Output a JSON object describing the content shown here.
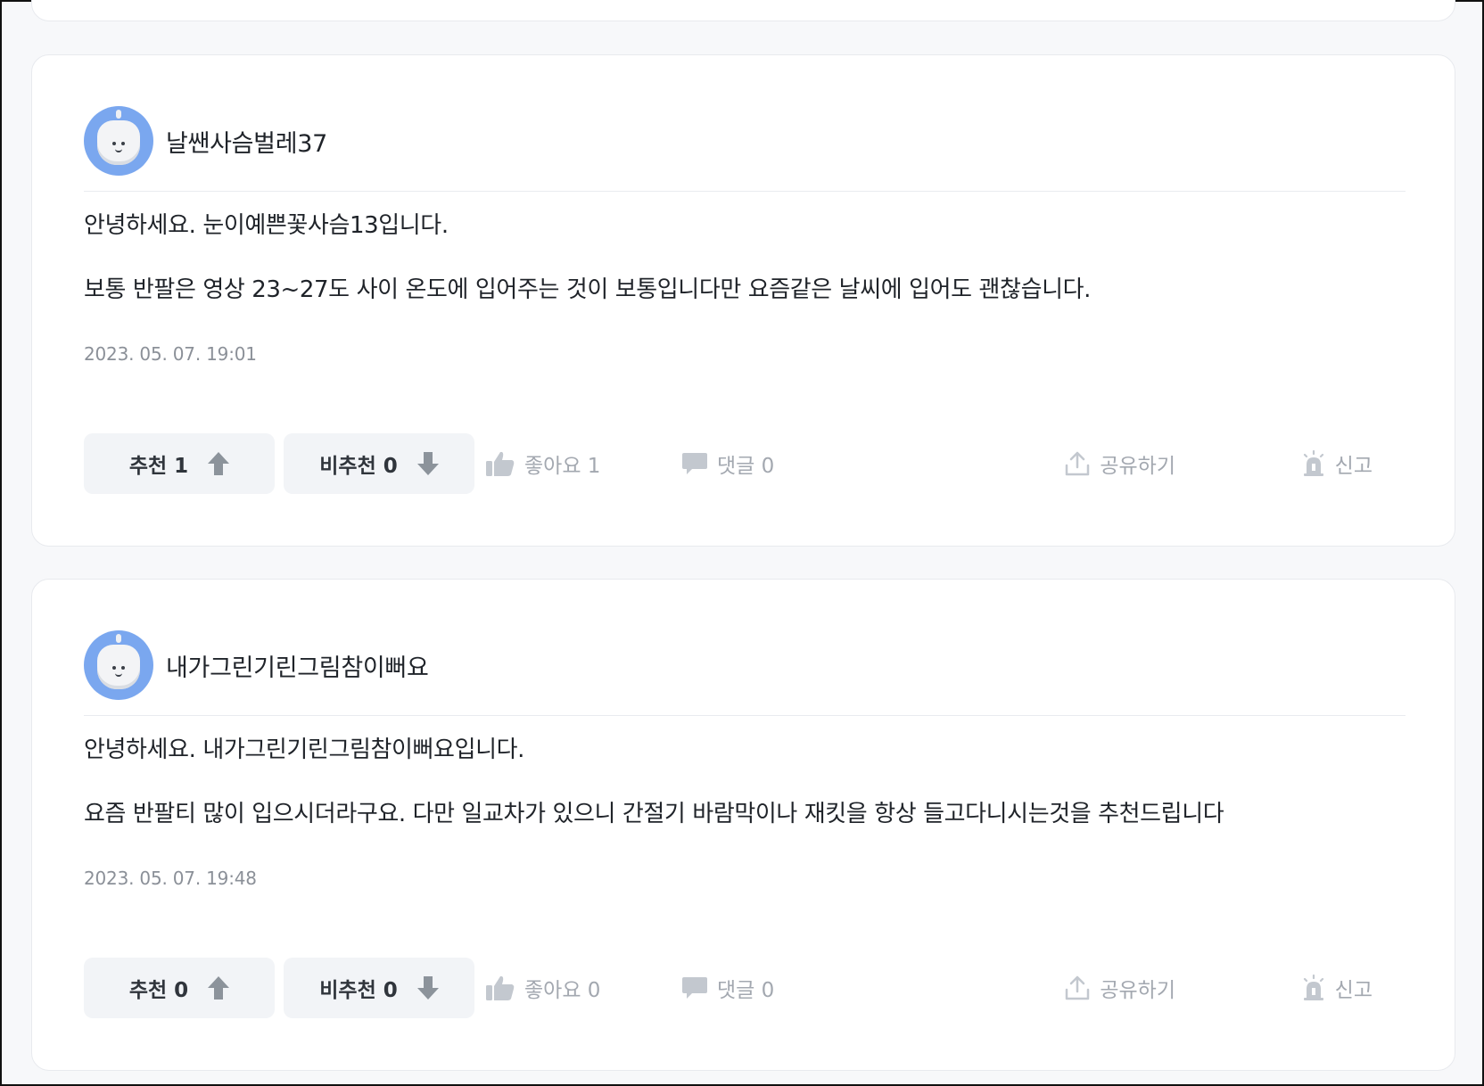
{
  "answers": [
    {
      "author": "날쌘사슴벌레37",
      "greeting": "안녕하세요. 눈이예쁜꽃사슴13입니다.",
      "body": "보통 반팔은 영상 23~27도 사이 온도에 입어주는 것이 보통입니다만 요즘같은 날씨에 입어도 괜찮습니다.",
      "date": "2023. 05. 07. 19:01",
      "upvote": "추천 1",
      "downvote": "비추천 0",
      "like": "좋아요 1",
      "comment": "댓글 0",
      "share": "공유하기",
      "report": "신고"
    },
    {
      "author": "내가그린기린그림참이뻐요",
      "greeting": "안녕하세요. 내가그린기린그림참이뻐요입니다.",
      "body": "요즘 반팔티 많이 입으시더라구요. 다만 일교차가 있으니 간절기 바람막이나 재킷을 항상 들고다니시는것을 추천드립니다",
      "date": "2023. 05. 07. 19:48",
      "upvote": "추천 0",
      "downvote": "비추천 0",
      "like": "좋아요 0",
      "comment": "댓글 0",
      "share": "공유하기",
      "report": "신고"
    }
  ],
  "icons": {
    "avatar": "robot-avatar-icon",
    "upvote": "arrow-up-icon",
    "downvote": "arrow-down-icon",
    "like": "thumbs-up-icon",
    "comment": "speech-bubble-icon",
    "share": "share-upload-icon",
    "report": "siren-icon"
  },
  "colors": {
    "page_bg": "#f7f8fa",
    "card_bg": "#ffffff",
    "avatar_bg": "#7aa7ef",
    "muted": "#a3a8b0",
    "vote_bg": "#f2f4f7"
  }
}
